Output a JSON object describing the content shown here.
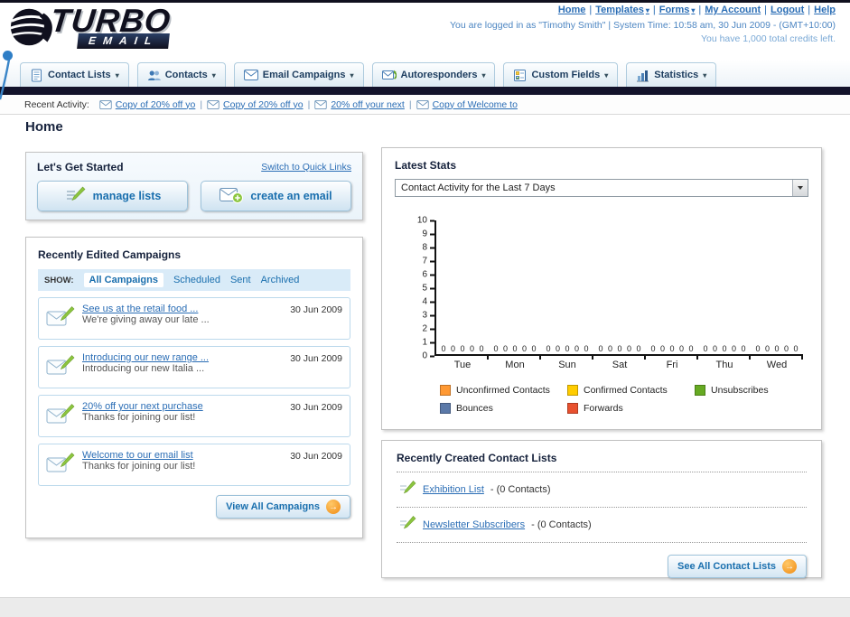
{
  "ui": {
    "separator": "|",
    "dropdown_arrow": "▾",
    "arrow_right": "→"
  },
  "header": {
    "logo_title": "TURBO",
    "logo_subtitle": "EMAIL",
    "links": [
      {
        "label": "Home"
      },
      {
        "label": "Templates"
      },
      {
        "label": "Forms"
      },
      {
        "label": "My Account"
      },
      {
        "label": "Logout"
      },
      {
        "label": "Help"
      }
    ],
    "login_info": "You are logged in as \"Timothy Smith\" | System Time: 10:58 am, 30 Jun 2009 - (GMT+10:00)",
    "credits_info": "You have 1,000 total credits left."
  },
  "nav_tabs": [
    {
      "label": "Contact Lists"
    },
    {
      "label": "Contacts"
    },
    {
      "label": "Email Campaigns"
    },
    {
      "label": "Autoresponders"
    },
    {
      "label": "Custom Fields"
    },
    {
      "label": "Statistics"
    }
  ],
  "recent_activity": {
    "label": "Recent Activity:",
    "items": [
      {
        "text": "Copy of 20% off yo"
      },
      {
        "text": "Copy of 20% off yo"
      },
      {
        "text": "20% off your next"
      },
      {
        "text": "Copy of Welcome to"
      }
    ]
  },
  "page": {
    "title": "Home"
  },
  "get_started": {
    "title": "Let's Get Started",
    "switch_link": "Switch to Quick Links",
    "manage_lists_button": "manage lists",
    "create_email_button": "create an email"
  },
  "campaigns": {
    "title": "Recently Edited Campaigns",
    "show_label": "SHOW:",
    "filters": [
      {
        "label": "All Campaigns",
        "active": true
      },
      {
        "label": "Scheduled"
      },
      {
        "label": "Sent"
      },
      {
        "label": "Archived"
      }
    ],
    "items": [
      {
        "title": "See us at the retail food ...",
        "subtitle": "We're giving away our late ...",
        "date": "30 Jun 2009"
      },
      {
        "title": "Introducing our new range ...",
        "subtitle": "Introducing our new Italia ...",
        "date": "30 Jun 2009"
      },
      {
        "title": "20% off your next purchase",
        "subtitle": "Thanks for joining our list!",
        "date": "30 Jun 2009"
      },
      {
        "title": "Welcome to our email list",
        "subtitle": "Thanks for joining our list!",
        "date": "30 Jun 2009"
      }
    ],
    "view_all_button": "View All Campaigns"
  },
  "stats": {
    "title": "Latest Stats",
    "dropdown_value": "Contact Activity for the Last 7 Days"
  },
  "contact_lists": {
    "title": "Recently Created Contact Lists",
    "items": [
      {
        "name": "Exhibition List",
        "suffix": "- (0 Contacts)"
      },
      {
        "name": "Newsletter Subscribers",
        "suffix": "- (0 Contacts)"
      }
    ],
    "see_all_button": "See All Contact Lists"
  },
  "chart_data": {
    "type": "bar",
    "title": "Contact Activity for the Last 7 Days",
    "categories": [
      "Tue",
      "Mon",
      "Sun",
      "Sat",
      "Fri",
      "Thu",
      "Wed"
    ],
    "series": [
      {
        "name": "Unconfirmed Contacts",
        "color": "#FF9933",
        "values": [
          0,
          0,
          0,
          0,
          0,
          0,
          0
        ]
      },
      {
        "name": "Confirmed Contacts",
        "color": "#FFCC00",
        "values": [
          0,
          0,
          0,
          0,
          0,
          0,
          0
        ]
      },
      {
        "name": "Unsubscribes",
        "color": "#66AA22",
        "values": [
          0,
          0,
          0,
          0,
          0,
          0,
          0
        ]
      },
      {
        "name": "Bounces",
        "color": "#5B79A8",
        "values": [
          0,
          0,
          0,
          0,
          0,
          0,
          0
        ]
      },
      {
        "name": "Forwards",
        "color": "#E8512F",
        "values": [
          0,
          0,
          0,
          0,
          0,
          0,
          0
        ]
      }
    ],
    "ylim": [
      0,
      10
    ],
    "yticks": [
      0,
      1,
      2,
      3,
      4,
      5,
      6,
      7,
      8,
      9,
      10
    ],
    "grid": false,
    "legend_position": "bottom",
    "xlabel": "",
    "ylabel": ""
  }
}
